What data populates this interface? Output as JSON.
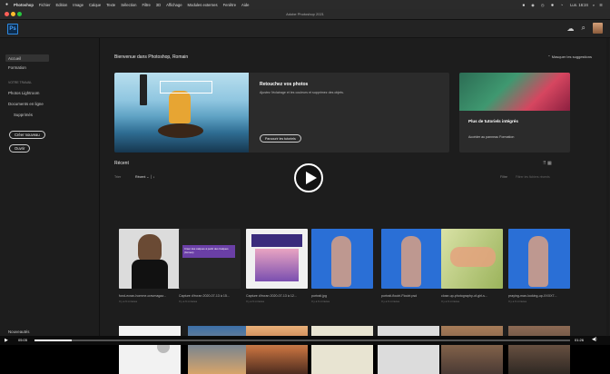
{
  "menubar": {
    "app": "Photoshop",
    "items": [
      "Fichier",
      "Edition",
      "Image",
      "Calque",
      "Texte",
      "Sélection",
      "Filtre",
      "3D",
      "Affichage",
      "Modules externes",
      "Fenêtre",
      "Aide"
    ],
    "clock": "Lun. 16:24"
  },
  "window": {
    "title": "Adobe Photoshop 2021"
  },
  "app": {
    "logo": "Ps"
  },
  "sidebar": {
    "items": [
      "Accueil",
      "Formation"
    ],
    "section": "VOTRE TRAVAIL",
    "work": [
      "Photos Lightroom",
      "Documents en ligne",
      "Supprimés"
    ],
    "create": "Créer nouveau",
    "open": "Ouvrir",
    "footer": "Nouveautés"
  },
  "main": {
    "welcome": "Bienvenue dans Photoshop, Romain",
    "hide": "Masquer les suggestions",
    "banner": {
      "title": "Retouchez vos photos",
      "desc": "Ajustez l'éclairage et les couleurs et supprimez des objets.",
      "button": "Parcourir les tutoriels"
    },
    "side_banner": {
      "title": "Plus de tutoriels intégrés",
      "link": "Accéder au panneau Formation"
    },
    "recent": "Récent",
    "sort_label": "Trier",
    "sort_value": "Récent",
    "filter_label": "Filtre",
    "filter_placeholder": "Filtrer les fichiers récents"
  },
  "files": [
    {
      "name": "fond-ecran-homme-cravmagaz...",
      "sub": "Il y a 6 minutes"
    },
    {
      "name": "Capture d'écran 2020-07-13 à 15...",
      "sub": "Il y a 6 minutes"
    },
    {
      "name": "Capture d'écran 2020-07-13 à 12...",
      "sub": "Il y a 6 minutes"
    },
    {
      "name": "portrait.jpg",
      "sub": "Il y a 6 minutes"
    },
    {
      "name": "portrait-flouté-Flouté.psd",
      "sub": "Il y a 6 minutes"
    },
    {
      "name": "close-up-photography-of-girl-s...",
      "sub": "Il y a 6 minutes"
    },
    {
      "name": "praying-man-looking-up-XXXX7...",
      "sub": "Il y a 6 minutes"
    }
  ],
  "thumb_text": "Créer des calques à partir des Calques (formes)",
  "video": {
    "elapsed": "05:05",
    "remaining": "01:26"
  }
}
